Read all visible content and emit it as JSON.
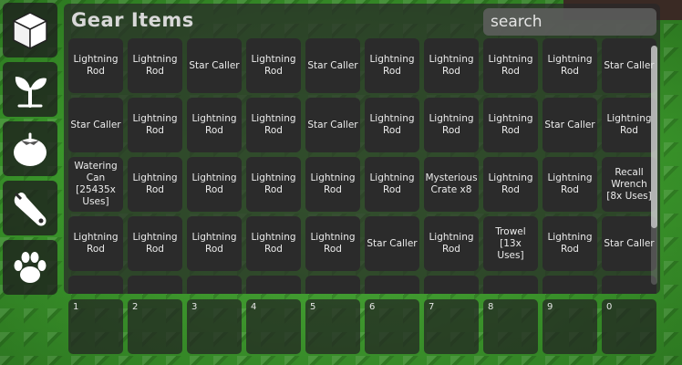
{
  "inventory": {
    "title": "Gear Items",
    "search_placeholder": "search",
    "items": [
      "Lightning Rod",
      "Lightning Rod",
      "Star Caller",
      "Lightning Rod",
      "Star Caller",
      "Lightning Rod",
      "Lightning Rod",
      "Lightning Rod",
      "Lightning Rod",
      "Star Caller",
      "Star Caller",
      "Lightning Rod",
      "Lightning Rod",
      "Lightning Rod",
      "Star Caller",
      "Lightning Rod",
      "Lightning Rod",
      "Lightning Rod",
      "Star Caller",
      "Lightning Rod",
      "Watering Can [25435x Uses]",
      "Lightning Rod",
      "Lightning Rod",
      "Lightning Rod",
      "Lightning Rod",
      "Lightning Rod",
      "Mysterious Crate x8",
      "Lightning Rod",
      "Lightning Rod",
      "Recall Wrench [8x Uses]",
      "Lightning Rod",
      "Lightning Rod",
      "Lightning Rod",
      "Lightning Rod",
      "Lightning Rod",
      "Star Caller",
      "Lightning Rod",
      "Trowel [13x Uses]",
      "Lightning Rod",
      "Star Caller",
      "",
      "",
      "",
      "",
      "",
      "",
      "",
      "",
      "",
      ""
    ]
  },
  "sidebar": {
    "buttons": [
      {
        "name": "cube-icon"
      },
      {
        "name": "sprout-icon"
      },
      {
        "name": "tomato-icon"
      },
      {
        "name": "wrench-icon"
      },
      {
        "name": "paw-icon"
      }
    ]
  },
  "hotbar": {
    "slots": [
      "1",
      "2",
      "3",
      "4",
      "5",
      "6",
      "7",
      "8",
      "9",
      "0"
    ]
  },
  "colors": {
    "panel": "#2b2b2b",
    "grass": "#3f9a2e",
    "text": "#ececec"
  }
}
